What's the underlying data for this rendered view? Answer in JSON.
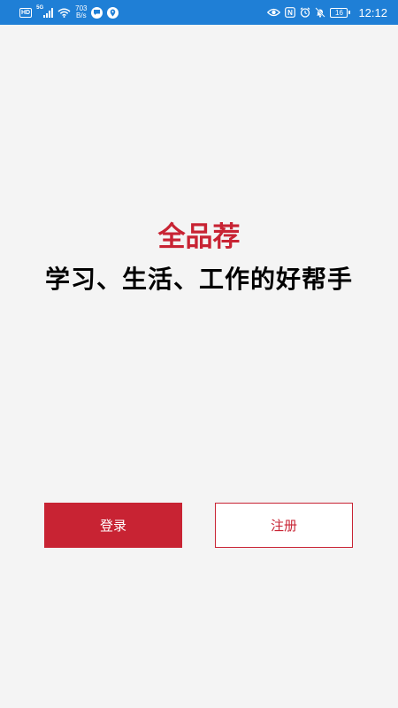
{
  "status_bar": {
    "hd_badge": "HD",
    "network_gen": "5G",
    "speed_value": "703",
    "speed_unit": "B/s",
    "app_icon_1": "chat-bubble-icon",
    "app_icon_2": "location-pin-icon",
    "nfc_label": "N",
    "battery_level": "16",
    "time": "12:12",
    "background_color": "#1f7fd6"
  },
  "hero": {
    "title": "全品荐",
    "slogan": "学习、生活、工作的好帮手",
    "title_color": "#c82333"
  },
  "buttons": {
    "login_label": "登录",
    "register_label": "注册",
    "accent_color": "#c82333"
  }
}
